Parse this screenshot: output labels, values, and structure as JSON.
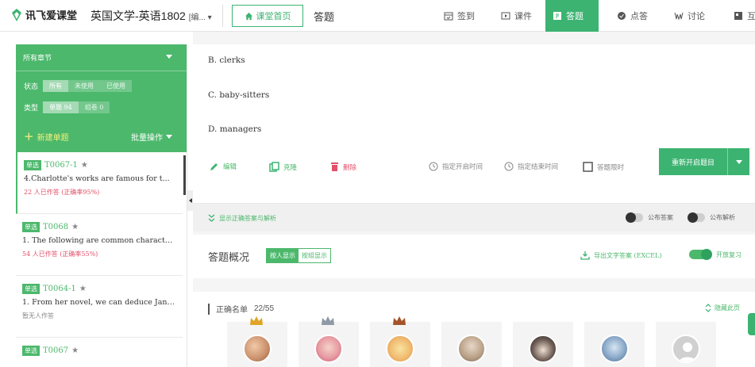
{
  "topbar": {
    "brand": "讯飞爱课堂",
    "course": "英国文学-英语1802",
    "course_suffix": "[编... ▾",
    "home_label": "课堂首页",
    "crumb": "答题",
    "nav": [
      {
        "label": "签到",
        "icon": "calendar-icon"
      },
      {
        "label": "课件",
        "icon": "slides-icon"
      },
      {
        "label": "答题",
        "icon": "quiz-icon",
        "active": true
      },
      {
        "label": "点答",
        "icon": "check-icon"
      },
      {
        "label": "讨论",
        "icon": "discussion-icon"
      },
      {
        "label": "互",
        "icon": "interact-icon"
      }
    ]
  },
  "sidebar": {
    "chapter": "所有章节",
    "status_label": "状态",
    "status_options": [
      "所有",
      "未使用",
      "已使用"
    ],
    "type_label": "类型",
    "type_options": [
      "单题 94",
      "组卷 0"
    ],
    "new_label": "新建单题",
    "batch_label": "批量操作",
    "items": [
      {
        "tag": "单选",
        "id": "T0067-1",
        "text": "4.Charlotte's works are famous for t...",
        "stat": "22 人已作答 (正确率95%)"
      },
      {
        "tag": "单选",
        "id": "T0068",
        "text": "1. The following are common characters ...",
        "stat": "54 人已作答 (正确率55%)"
      },
      {
        "tag": "单选",
        "id": "T0064-1",
        "text": "1. From her novel, we can deduce Jane ...",
        "stat": "暂无人作答"
      },
      {
        "tag": "单选",
        "id": "T0067",
        "text": "",
        "stat": ""
      }
    ]
  },
  "main": {
    "options": [
      "B.  clerks",
      "C.  baby-sitters",
      "D.  managers"
    ],
    "actions": {
      "edit": "编辑",
      "clone": "克隆",
      "delete": "删除",
      "start_time": "指定开启时间",
      "end_time": "指定结束时间",
      "time_limit": "答题限时",
      "restart": "重新开启题目"
    },
    "show_answer": "显示正确答案与解析",
    "publish_answer": "公布答案",
    "publish_analysis": "公布解析",
    "overview_title": "答题概况",
    "mode_options": [
      "按人显示",
      "按组显示"
    ],
    "export_label": "导出文字答案 (EXCEL)",
    "review_label": "开放复习",
    "correct_label": "正确名单",
    "correct_count": "22/55",
    "hide_label": "隐藏此页",
    "avatars": [
      {
        "crown": "gold"
      },
      {
        "crown": "silver"
      },
      {
        "crown": "bronze"
      },
      {
        "crown": ""
      },
      {
        "crown": ""
      },
      {
        "crown": ""
      },
      {
        "crown": ""
      }
    ]
  },
  "colors": {
    "accent": "#3cb371",
    "danger": "#e2506a"
  }
}
